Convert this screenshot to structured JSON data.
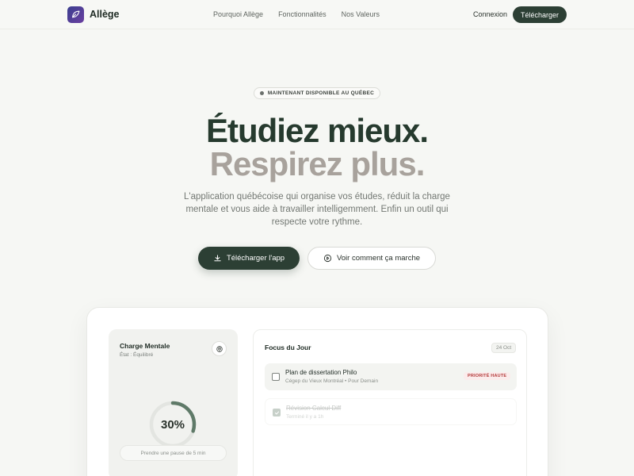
{
  "nav": {
    "brand": "Allège",
    "links": [
      "Pourquoi Allège",
      "Fonctionnalités",
      "Nos Valeurs"
    ],
    "login": "Connexion",
    "download": "Télécharger"
  },
  "hero": {
    "badge": "MAINTENANT DISPONIBLE AU QUÉBEC",
    "headline_line1": "Étudiez mieux.",
    "headline_line2": "Respirez plus.",
    "subtitle": "L'application québécoise qui organise vos études, réduit la charge mentale et vous aide à travailler intelligemment. Enfin un outil qui respecte votre rythme.",
    "primary_cta": "Télécharger l'app",
    "secondary_cta": "Voir comment ça marche"
  },
  "preview": {
    "mental_load": {
      "title": "Charge Mentale",
      "state": "État : Équilibré",
      "percent_label": "30%",
      "percent_value": 0.3,
      "pause_button": "Prendre une pause de 5 min"
    },
    "focus": {
      "title": "Focus du Jour",
      "date": "24 Oct",
      "tasks": [
        {
          "title": "Plan de dissertation Philo",
          "meta": "Cégep du Vieux Montréal • Pour Demain",
          "priority": "PRIORITÉ HAUTE",
          "done": false
        },
        {
          "title": "Révision Calcul Diff",
          "meta": "Terminé il y a 1h",
          "done": true
        }
      ]
    }
  },
  "colors": {
    "accent": "#2c3f34",
    "muted_headline": "#a8a29c",
    "priority_text": "#b33b3b",
    "ring_progress": "#5f7a68"
  }
}
